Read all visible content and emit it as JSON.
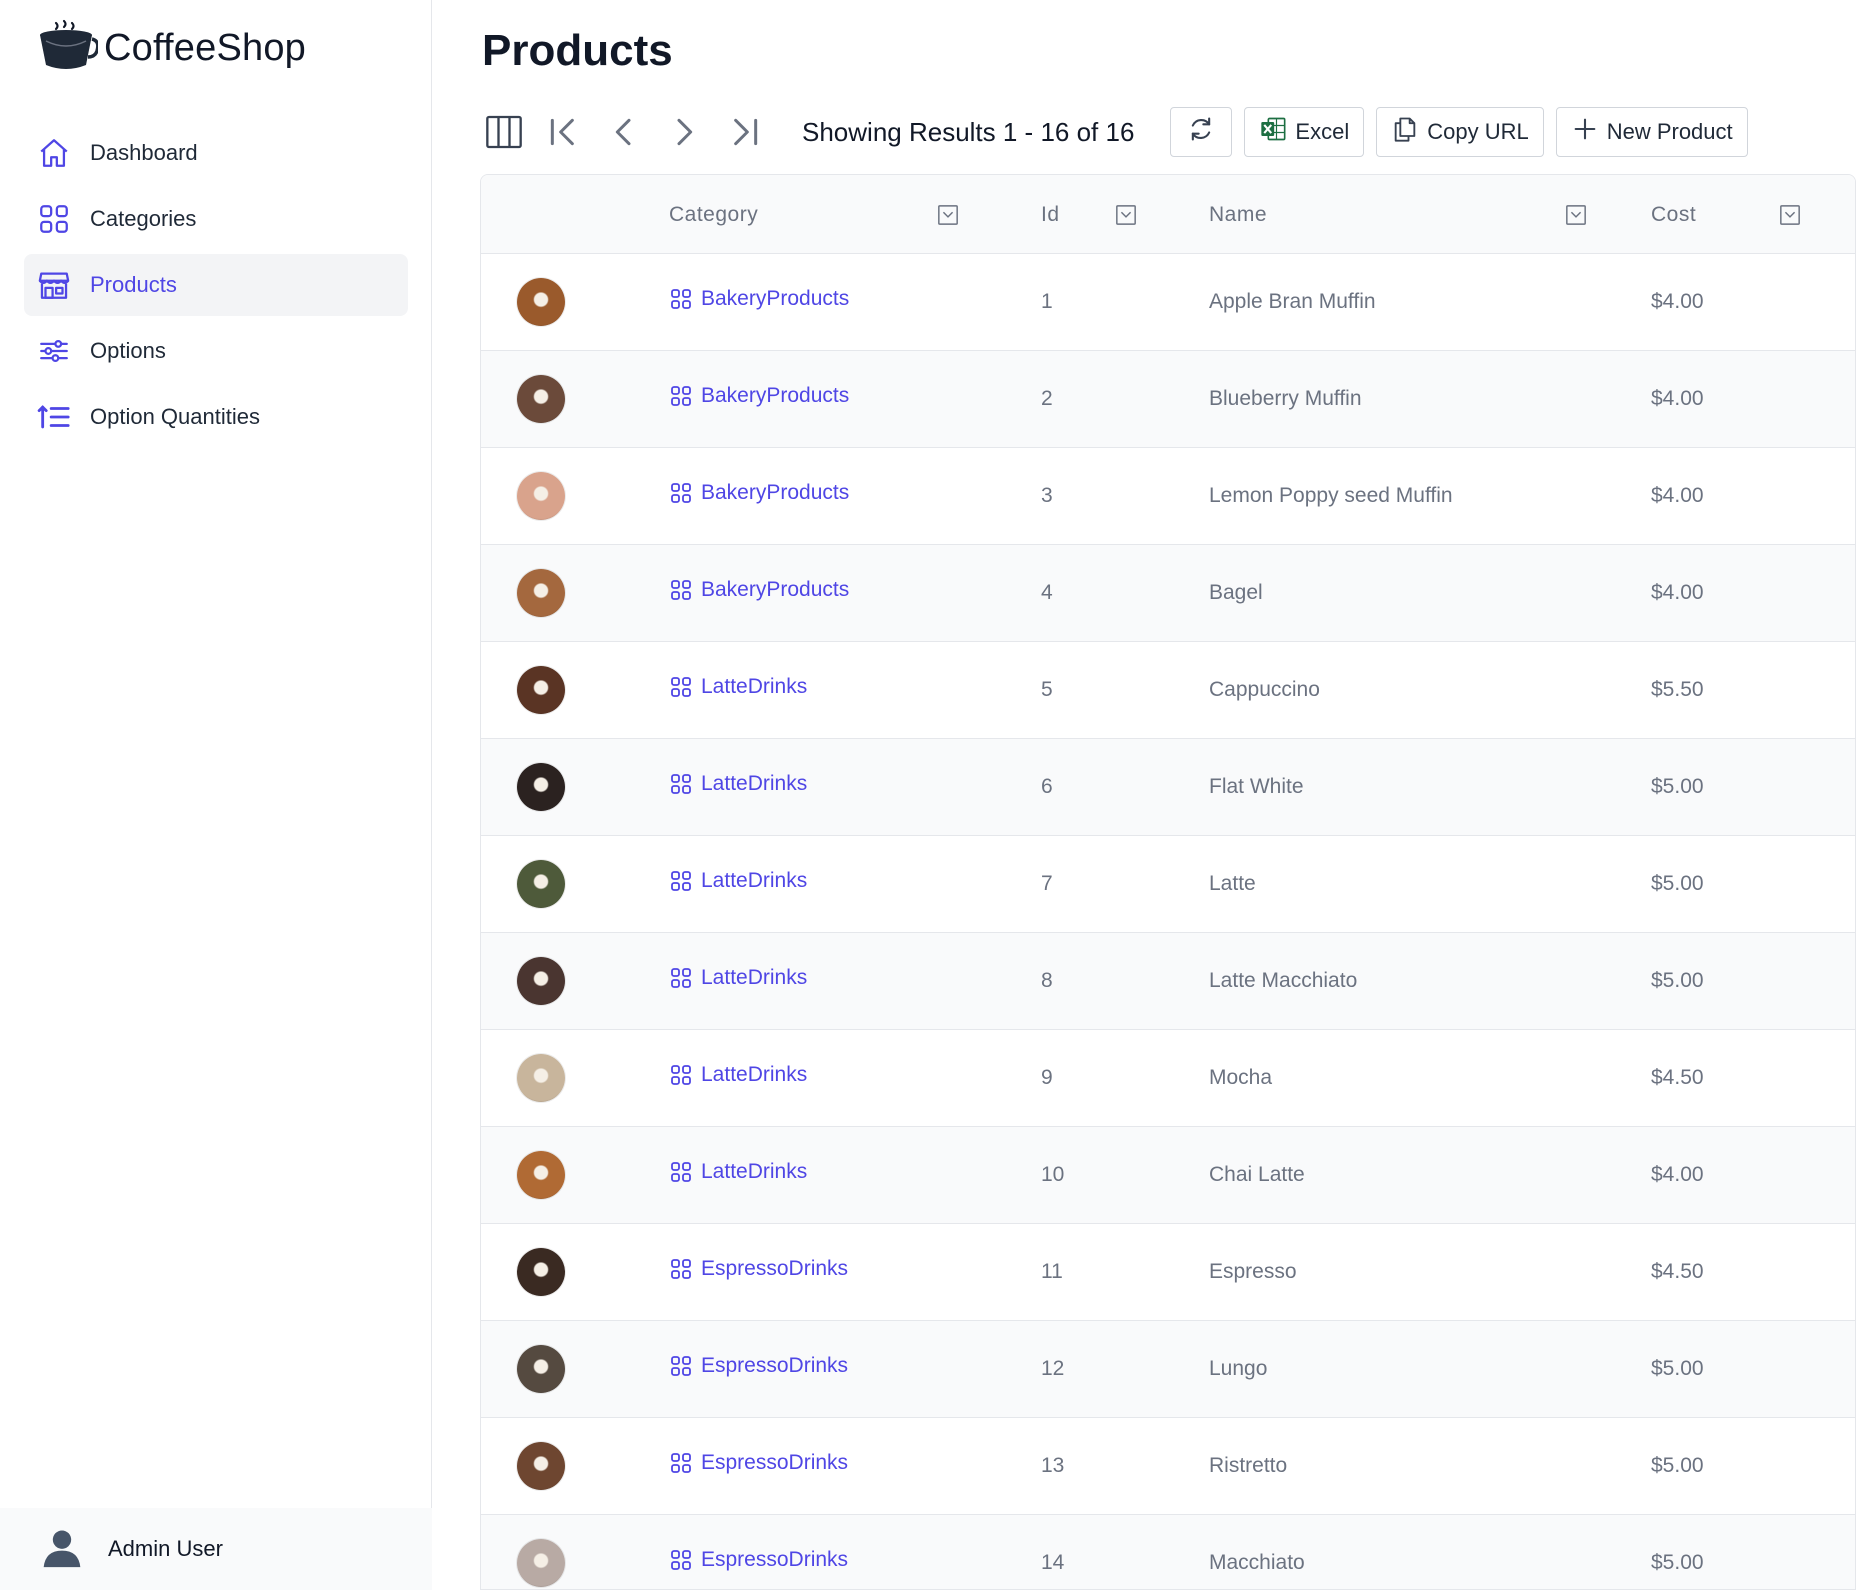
{
  "brand": {
    "name": "CoffeeShop"
  },
  "sidebar": {
    "items": [
      {
        "label": "Dashboard",
        "icon": "home-icon",
        "active": false
      },
      {
        "label": "Categories",
        "icon": "squares-icon",
        "active": false
      },
      {
        "label": "Products",
        "icon": "storefront-icon",
        "active": true
      },
      {
        "label": "Options",
        "icon": "sliders-icon",
        "active": false
      },
      {
        "label": "Option Quantities",
        "icon": "sort-list-icon",
        "active": false
      }
    ],
    "user": {
      "name": "Admin User"
    }
  },
  "page": {
    "title": "Products"
  },
  "toolbar": {
    "results_text": "Showing Results 1 - 16 of 16",
    "excel_label": "Excel",
    "copy_url_label": "Copy URL",
    "new_label": "New Product"
  },
  "table": {
    "columns": [
      "Category",
      "Id",
      "Name",
      "Cost"
    ],
    "rows": [
      {
        "category": "BakeryProducts",
        "id": "1",
        "name": "Apple Bran Muffin",
        "cost": "$4.00",
        "color": "#9a5a2c"
      },
      {
        "category": "BakeryProducts",
        "id": "2",
        "name": "Blueberry Muffin",
        "cost": "$4.00",
        "color": "#6b4a3a"
      },
      {
        "category": "BakeryProducts",
        "id": "3",
        "name": "Lemon Poppy seed Muffin",
        "cost": "$4.00",
        "color": "#d9a38c"
      },
      {
        "category": "BakeryProducts",
        "id": "4",
        "name": "Bagel",
        "cost": "$4.00",
        "color": "#a4683e"
      },
      {
        "category": "LatteDrinks",
        "id": "5",
        "name": "Cappuccino",
        "cost": "$5.50",
        "color": "#5a3424"
      },
      {
        "category": "LatteDrinks",
        "id": "6",
        "name": "Flat White",
        "cost": "$5.00",
        "color": "#2b2220"
      },
      {
        "category": "LatteDrinks",
        "id": "7",
        "name": "Latte",
        "cost": "$5.00",
        "color": "#4e5a3a"
      },
      {
        "category": "LatteDrinks",
        "id": "8",
        "name": "Latte Macchiato",
        "cost": "$5.00",
        "color": "#4a3530"
      },
      {
        "category": "LatteDrinks",
        "id": "9",
        "name": "Mocha",
        "cost": "$4.50",
        "color": "#c8b59c"
      },
      {
        "category": "LatteDrinks",
        "id": "10",
        "name": "Chai Latte",
        "cost": "$4.00",
        "color": "#b06a34"
      },
      {
        "category": "EspressoDrinks",
        "id": "11",
        "name": "Espresso",
        "cost": "$4.50",
        "color": "#3a2a22"
      },
      {
        "category": "EspressoDrinks",
        "id": "12",
        "name": "Lungo",
        "cost": "$5.00",
        "color": "#554a40"
      },
      {
        "category": "EspressoDrinks",
        "id": "13",
        "name": "Ristretto",
        "cost": "$5.00",
        "color": "#6e4630"
      },
      {
        "category": "EspressoDrinks",
        "id": "14",
        "name": "Macchiato",
        "cost": "$5.00",
        "color": "#b8aaa4"
      }
    ]
  },
  "colors": {
    "accent": "#4f46e5",
    "muted_text": "#6b7280",
    "excel_green": "#1d6f42"
  }
}
